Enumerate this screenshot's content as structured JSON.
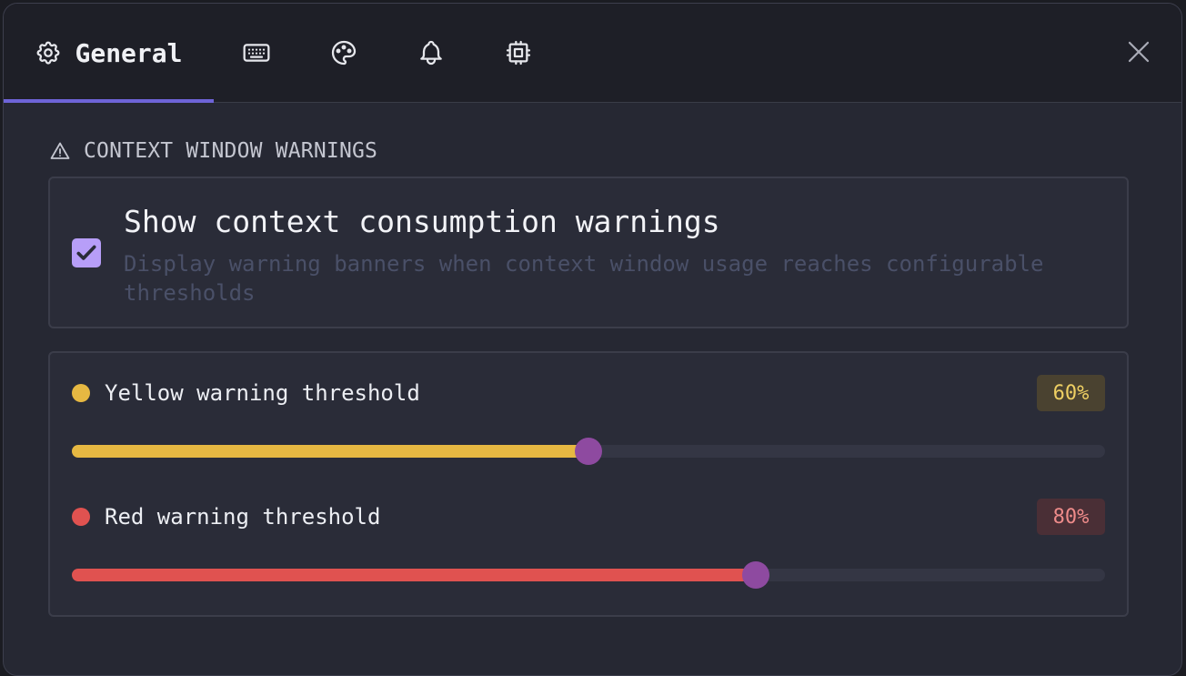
{
  "tabs": [
    {
      "name": "general",
      "label": "General",
      "icon": "gear-icon",
      "active": true
    },
    {
      "name": "keyboard",
      "icon": "keyboard-icon"
    },
    {
      "name": "appearance",
      "icon": "palette-icon"
    },
    {
      "name": "notifications",
      "icon": "bell-icon"
    },
    {
      "name": "models",
      "icon": "chip-icon"
    }
  ],
  "close_icon": "close-icon",
  "section": {
    "icon": "warning-triangle-icon",
    "title": "CONTEXT WINDOW WARNINGS"
  },
  "warnings_toggle": {
    "checked": true,
    "title": "Show context consumption warnings",
    "description": "Display warning banners when context window usage reaches configurable thresholds"
  },
  "thresholds": [
    {
      "label": "Yellow warning threshold",
      "value_label": "60%",
      "value": 60,
      "slider_fill_fraction": 0.5,
      "color": "#e6b842",
      "badge_bg": "#4a4230",
      "badge_fg": "#eecf63"
    },
    {
      "label": "Red warning threshold",
      "value_label": "80%",
      "value": 80,
      "slider_fill_fraction": 0.662,
      "color": "#e05250",
      "badge_bg": "#4a2f36",
      "badge_fg": "#ee8b8a"
    }
  ],
  "colors": {
    "accent": "#6e64d8",
    "thumb": "#8e4aa0",
    "checkbox": "#b79ef8"
  }
}
